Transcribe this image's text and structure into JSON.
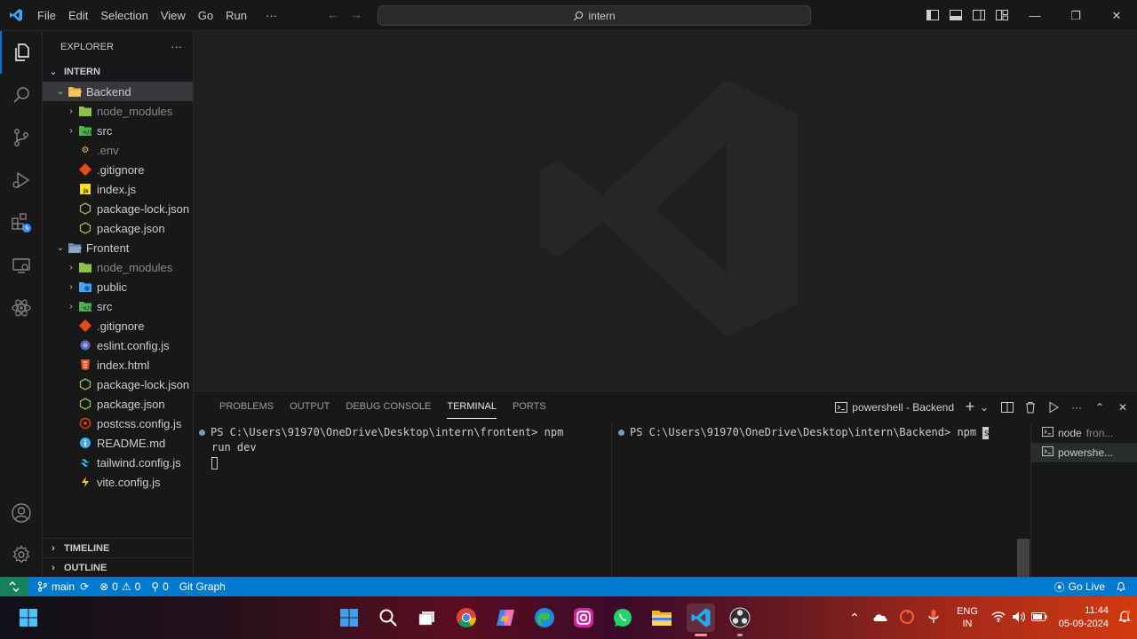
{
  "menu": [
    "File",
    "Edit",
    "Selection",
    "View",
    "Go",
    "Run",
    "···"
  ],
  "search": {
    "text": "intern"
  },
  "window": {
    "minimize": "—",
    "restore": "❐",
    "close": "✕"
  },
  "explorer": {
    "title": "EXPLORER",
    "more": "···",
    "root": "INTERN"
  },
  "tree": [
    {
      "label": "Backend",
      "type": "folder-open"
    },
    {
      "label": "node_modules",
      "type": "folder"
    },
    {
      "label": "src",
      "type": "folder"
    },
    {
      "label": ".env",
      "type": "file"
    },
    {
      "label": ".gitignore",
      "type": "file"
    },
    {
      "label": "index.js",
      "type": "file"
    },
    {
      "label": "package-lock.json",
      "type": "file"
    },
    {
      "label": "package.json",
      "type": "file"
    },
    {
      "label": "Frontent",
      "type": "folder-open"
    },
    {
      "label": "node_modules",
      "type": "folder"
    },
    {
      "label": "public",
      "type": "folder"
    },
    {
      "label": "src",
      "type": "folder"
    },
    {
      "label": ".gitignore",
      "type": "file"
    },
    {
      "label": "eslint.config.js",
      "type": "file"
    },
    {
      "label": "index.html",
      "type": "file"
    },
    {
      "label": "package-lock.json",
      "type": "file"
    },
    {
      "label": "package.json",
      "type": "file"
    },
    {
      "label": "postcss.config.js",
      "type": "file"
    },
    {
      "label": "README.md",
      "type": "file"
    },
    {
      "label": "tailwind.config.js",
      "type": "file"
    },
    {
      "label": "vite.config.js",
      "type": "file"
    }
  ],
  "timeline": "TIMELINE",
  "outline": "OUTLINE",
  "panel": {
    "tabs": [
      "PROBLEMS",
      "OUTPUT",
      "DEBUG CONSOLE",
      "TERMINAL",
      "PORTS"
    ],
    "terminal_name": "powershell - Backend",
    "term_left_line1": "PS C:\\Users\\91970\\OneDrive\\Desktop\\intern\\frontent> npm",
    "term_left_line2": "run dev",
    "term_right_line1": "PS C:\\Users\\91970\\OneDrive\\Desktop\\intern\\Backend> npm ",
    "term_right_cursor": "s",
    "term_list": [
      {
        "name": "node",
        "sub": "fron..."
      },
      {
        "name": "powershe...",
        "sub": ""
      }
    ]
  },
  "status": {
    "branch": "main",
    "errors": "0",
    "warnings": "0",
    "ports": "0",
    "git_graph": "Git Graph",
    "go_live": "Go Live"
  },
  "tray": {
    "lang_top": "ENG",
    "lang_bottom": "IN",
    "time": "11:44",
    "date": "05-09-2024"
  }
}
